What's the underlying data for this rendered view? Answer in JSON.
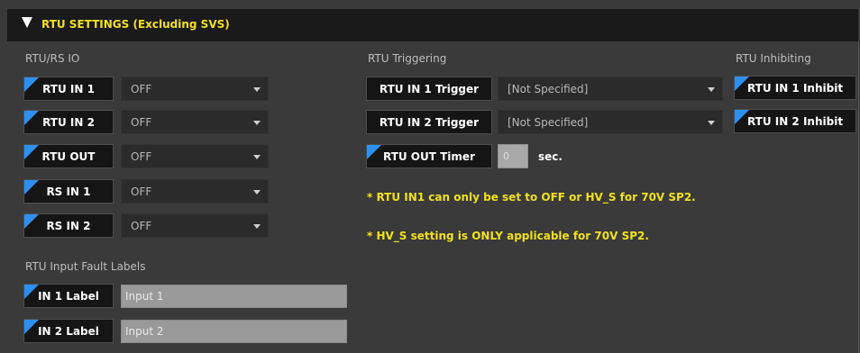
{
  "header": {
    "title": "RTU SETTINGS (Excluding SVS)"
  },
  "rtu_rs_io": {
    "heading": "RTU/RS IO",
    "rows": [
      {
        "label": "RTU IN 1",
        "value": "OFF"
      },
      {
        "label": "RTU IN 2",
        "value": "OFF"
      },
      {
        "label": "RTU OUT",
        "value": "OFF"
      },
      {
        "label": "RS IN 1",
        "value": "OFF"
      },
      {
        "label": "RS IN 2",
        "value": "OFF"
      }
    ]
  },
  "fault_labels": {
    "heading": "RTU Input Fault Labels",
    "rows": [
      {
        "label": "IN 1 Label",
        "value": "Input 1"
      },
      {
        "label": "IN 2 Label",
        "value": "Input 2"
      }
    ]
  },
  "triggering": {
    "heading": "RTU Triggering",
    "rows": [
      {
        "label": "RTU IN 1 Trigger",
        "value": "[Not Specified]"
      },
      {
        "label": "RTU IN 2 Trigger",
        "value": "[Not Specified]"
      }
    ],
    "timer": {
      "label": "RTU OUT Timer",
      "value": "0",
      "unit": "sec."
    }
  },
  "notes": [
    "* RTU IN1 can only be set to OFF or HV_S for 70V SP2.",
    "* HV_S setting is ONLY applicable for 70V SP2."
  ],
  "inhibiting": {
    "heading": "RTU Inhibiting",
    "buttons": [
      "RTU IN 1 Inhibit",
      "RTU IN 2 Inhibit"
    ]
  },
  "colors": {
    "accent": "#f2e01c",
    "flag": "#2d8ff0"
  }
}
